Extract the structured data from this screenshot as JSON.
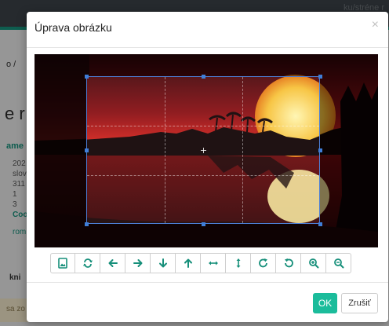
{
  "background": {
    "topbar_text": "ku/stréne r",
    "breadcrumb": "o /",
    "big_letter": "e r",
    "section_label": "ame",
    "details": [
      "202",
      "slov",
      "311",
      "1",
      "3"
    ],
    "teal_link": "Coo",
    "link": "rom",
    "footer_word": "kni",
    "footer_hint": "sa zo"
  },
  "modal": {
    "title": "Úprava obrázku",
    "close": "×",
    "ok_label": "OK",
    "cancel_label": "Zrušiť"
  },
  "toolbar": {
    "buttons": [
      {
        "name": "image-icon"
      },
      {
        "name": "swap-icon"
      },
      {
        "name": "arrow-left-icon"
      },
      {
        "name": "arrow-right-icon"
      },
      {
        "name": "arrow-down-icon"
      },
      {
        "name": "arrow-up-icon"
      },
      {
        "name": "flip-horizontal-icon"
      },
      {
        "name": "flip-vertical-icon"
      },
      {
        "name": "rotate-right-icon"
      },
      {
        "name": "rotate-left-icon"
      },
      {
        "name": "zoom-in-icon"
      },
      {
        "name": "zoom-out-icon"
      }
    ]
  },
  "colors": {
    "accent": "#1bbc9b",
    "crop_border": "#3f7ed8",
    "toolbar_icon": "#168f7a"
  }
}
